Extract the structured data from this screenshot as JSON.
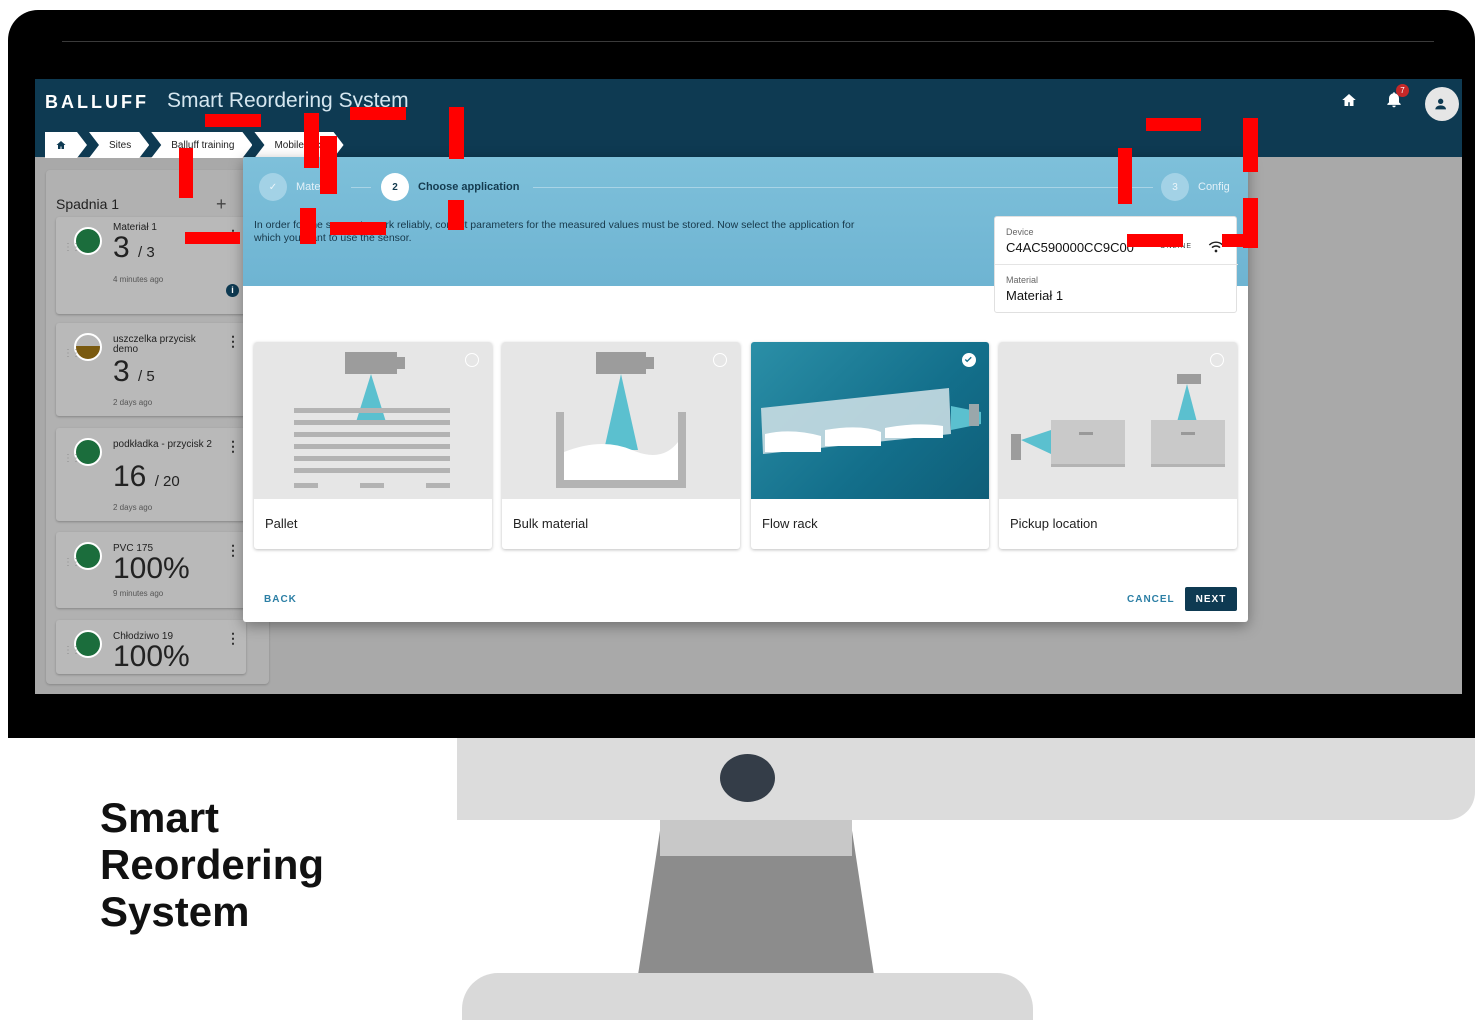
{
  "marketing": {
    "line1": "Smart",
    "line2": "Reordering",
    "line3": "System"
  },
  "app": {
    "logo": "BALLUFF",
    "title": "Smart Reordering System",
    "notification_count": "7"
  },
  "breadcrumb": [
    "Sites",
    "Balluff training",
    "Mobile rack"
  ],
  "panel": {
    "title": "Spadnia 1",
    "cards": [
      {
        "name": "Materiał 1",
        "count": "3",
        "total": "/ 3",
        "time": "4 minutes ago"
      },
      {
        "name": "uszczelka przycisk demo",
        "count": "3",
        "total": "/ 5",
        "time": "2 days ago"
      },
      {
        "name": "podkładka - przycisk 2",
        "count": "16",
        "total": "/ 20",
        "time": "2 days ago"
      },
      {
        "name": "PVC 175",
        "count": "100%",
        "total": "",
        "time": "9 minutes ago"
      },
      {
        "name": "Chłodziwo 19",
        "count": "100%",
        "total": "",
        "time": ""
      }
    ]
  },
  "wizard": {
    "steps": [
      {
        "num": "✓",
        "label": "Material"
      },
      {
        "num": "2",
        "label": "Choose application"
      },
      {
        "num": "3",
        "label": "Config"
      }
    ],
    "description": "In order for the sensor to work reliably, correct parameters for the measured values must be stored. Now select the application for which you want to use the sensor.",
    "device_label": "Device",
    "device_value": "C4AC590000CC9C00",
    "online": "ONLINE",
    "material_label": "Material",
    "material_value": "Materiał 1",
    "applications": [
      "Pallet",
      "Bulk material",
      "Flow rack",
      "Pickup location"
    ],
    "back": "BACK",
    "cancel": "CANCEL",
    "next": "NEXT"
  },
  "colors": {
    "appbar": "#0e3a52",
    "accent": "#2c7fa5",
    "highlight": "#ff0000"
  }
}
